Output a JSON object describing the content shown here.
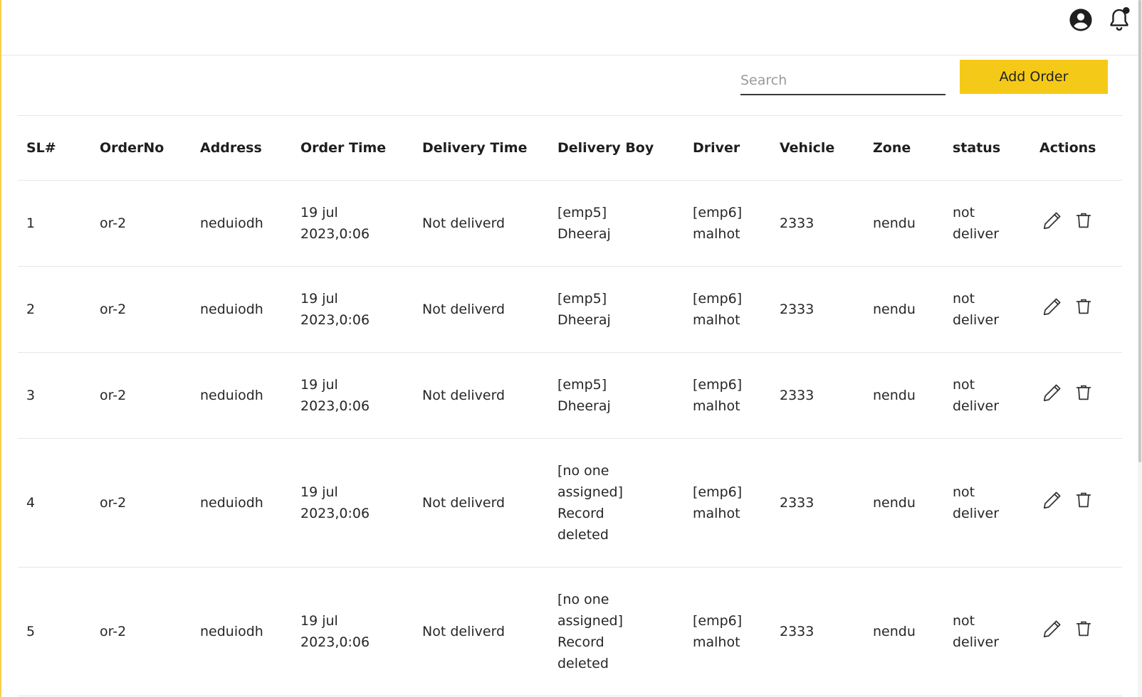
{
  "header": {
    "icons": [
      "account-circle-icon",
      "notification-bell-icon"
    ]
  },
  "toolbar": {
    "search_placeholder": "Search",
    "add_button_label": "Add Order",
    "add_button_color": "#f5c918"
  },
  "table": {
    "columns": [
      "SL#",
      "OrderNo",
      "Address",
      "Order Time",
      "Delivery Time",
      "Delivery Boy",
      "Driver",
      "Vehicle",
      "Zone",
      "status",
      "Actions"
    ],
    "rows": [
      {
        "sl": "1",
        "order_no": "or-2",
        "address": "neduiodh",
        "order_time_line1": "19 jul",
        "order_time_line2": "2023,0:06",
        "delivery_time": "Not deliverd",
        "delivery_boy": [
          "[emp5]",
          "Dheeraj"
        ],
        "driver_line1": "[emp6]",
        "driver_line2": "malhot",
        "vehicle": "2333",
        "zone": "nendu",
        "status_line1": "not",
        "status_line2": "deliver"
      },
      {
        "sl": "2",
        "order_no": "or-2",
        "address": "neduiodh",
        "order_time_line1": "19 jul",
        "order_time_line2": "2023,0:06",
        "delivery_time": "Not deliverd",
        "delivery_boy": [
          "[emp5]",
          "Dheeraj"
        ],
        "driver_line1": "[emp6]",
        "driver_line2": "malhot",
        "vehicle": "2333",
        "zone": "nendu",
        "status_line1": "not",
        "status_line2": "deliver"
      },
      {
        "sl": "3",
        "order_no": "or-2",
        "address": "neduiodh",
        "order_time_line1": "19 jul",
        "order_time_line2": "2023,0:06",
        "delivery_time": "Not deliverd",
        "delivery_boy": [
          "[emp5]",
          "Dheeraj"
        ],
        "driver_line1": "[emp6]",
        "driver_line2": "malhot",
        "vehicle": "2333",
        "zone": "nendu",
        "status_line1": "not",
        "status_line2": "deliver"
      },
      {
        "sl": "4",
        "order_no": "or-2",
        "address": "neduiodh",
        "order_time_line1": "19 jul",
        "order_time_line2": "2023,0:06",
        "delivery_time": "Not deliverd",
        "delivery_boy": [
          "[no one",
          "assigned]",
          "Record",
          "deleted"
        ],
        "driver_line1": "[emp6]",
        "driver_line2": "malhot",
        "vehicle": "2333",
        "zone": "nendu",
        "status_line1": "not",
        "status_line2": "deliver"
      },
      {
        "sl": "5",
        "order_no": "or-2",
        "address": "neduiodh",
        "order_time_line1": "19 jul",
        "order_time_line2": "2023,0:06",
        "delivery_time": "Not deliverd",
        "delivery_boy": [
          "[no one",
          "assigned]",
          "Record",
          "deleted"
        ],
        "driver_line1": "[emp6]",
        "driver_line2": "malhot",
        "vehicle": "2333",
        "zone": "nendu",
        "status_line1": "not",
        "status_line2": "deliver"
      }
    ],
    "row_actions": [
      "edit-pencil-icon",
      "delete-trash-icon"
    ]
  }
}
